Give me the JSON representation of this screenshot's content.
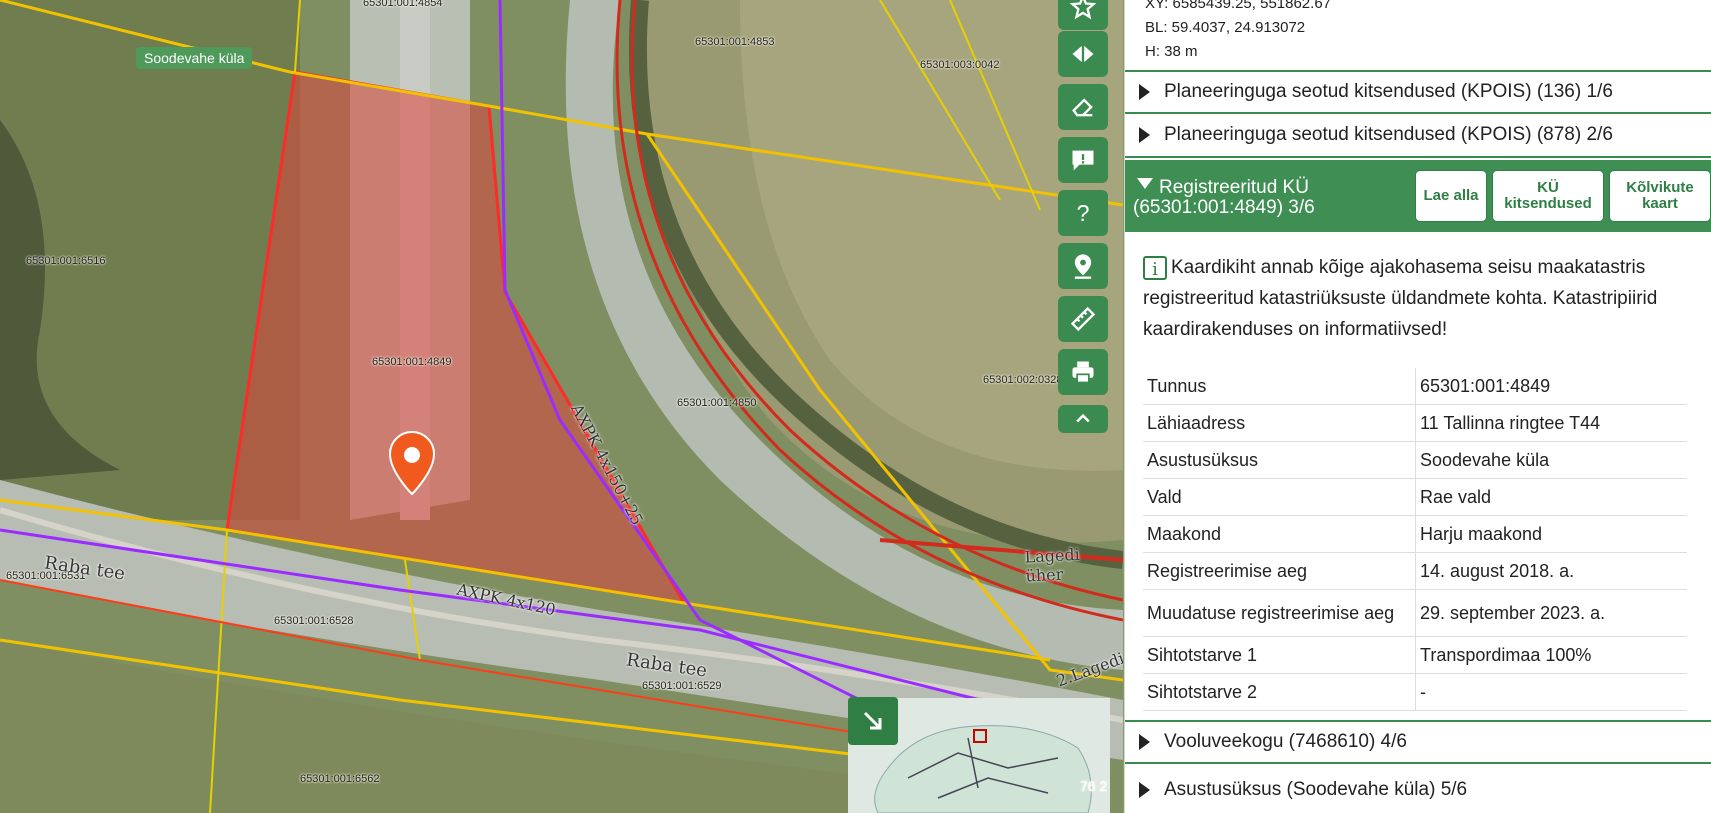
{
  "map": {
    "village_tag": "Soodevahe küla",
    "parcel_labels": [
      "65301:001:4854",
      "65301:001:4853",
      "65301:003:0042",
      "65301:001:6516",
      "65301:001:4849",
      "65301:001:4850",
      "65301:002:0328",
      "65301:001:6531",
      "65301:001:6528",
      "65301:001:6529",
      "65301:001:6562"
    ],
    "road_labels": [
      "Raba tee",
      "Raba tee",
      "AXPK 4x120",
      "AXPK 4x150+25",
      "Lagedi üher",
      "2.Lagedi"
    ],
    "minimap_label": "76 2"
  },
  "toolbar": {
    "icons": [
      "star-icon",
      "split-icon",
      "eraser-icon",
      "comment-icon",
      "help-icon",
      "location-icon",
      "ruler-icon",
      "print-icon",
      "chevron-up-icon"
    ]
  },
  "panel": {
    "coords": {
      "xy": "XY: 6585439.25, 551862.67",
      "bl": "BL: 59.4037, 24.913072",
      "h": "H: 38 m"
    },
    "sections": [
      {
        "label": "Planeeringuga seotud kitsendused (KPOIS) (136) 1/6"
      },
      {
        "label": "Planeeringuga seotud kitsendused (KPOIS) (878) 2/6"
      },
      {
        "label": "Registreeritud KÜ (65301:001:4849) 3/6"
      },
      {
        "label": "Vooluveekogu (7468610) 4/6"
      },
      {
        "label": "Asustusüksus (Soodevahe küla) 5/6"
      }
    ],
    "open_buttons": {
      "download": "Lae alla",
      "restrictions": "KÜ kitsendused",
      "valid_map": "Kõlvikute kaart"
    },
    "info_icon": "i",
    "info_text": "Kaardikiht annab kõige ajakohasema seisu maakatastris registreeritud katastriüksuste üldandmete kohta. Katastripiirid kaardirakenduses on informatiivsed!",
    "attributes": [
      {
        "key": "Tunnus",
        "value": "65301:001:4849"
      },
      {
        "key": "Lähiaadress",
        "value": "11 Tallinna ringtee T44"
      },
      {
        "key": "Asustusüksus",
        "value": "Soodevahe küla"
      },
      {
        "key": "Vald",
        "value": "Rae vald"
      },
      {
        "key": "Maakond",
        "value": "Harju maakond"
      },
      {
        "key": "Registreerimise aeg",
        "value": "14. august 2018. a."
      },
      {
        "key": "Muudatuse registreerimise aeg",
        "value": "29. september 2023. a."
      },
      {
        "key": "Sihtotstarve 1",
        "value": "Transpordimaa 100%"
      },
      {
        "key": "Sihtotstarve 2",
        "value": "-"
      }
    ]
  }
}
